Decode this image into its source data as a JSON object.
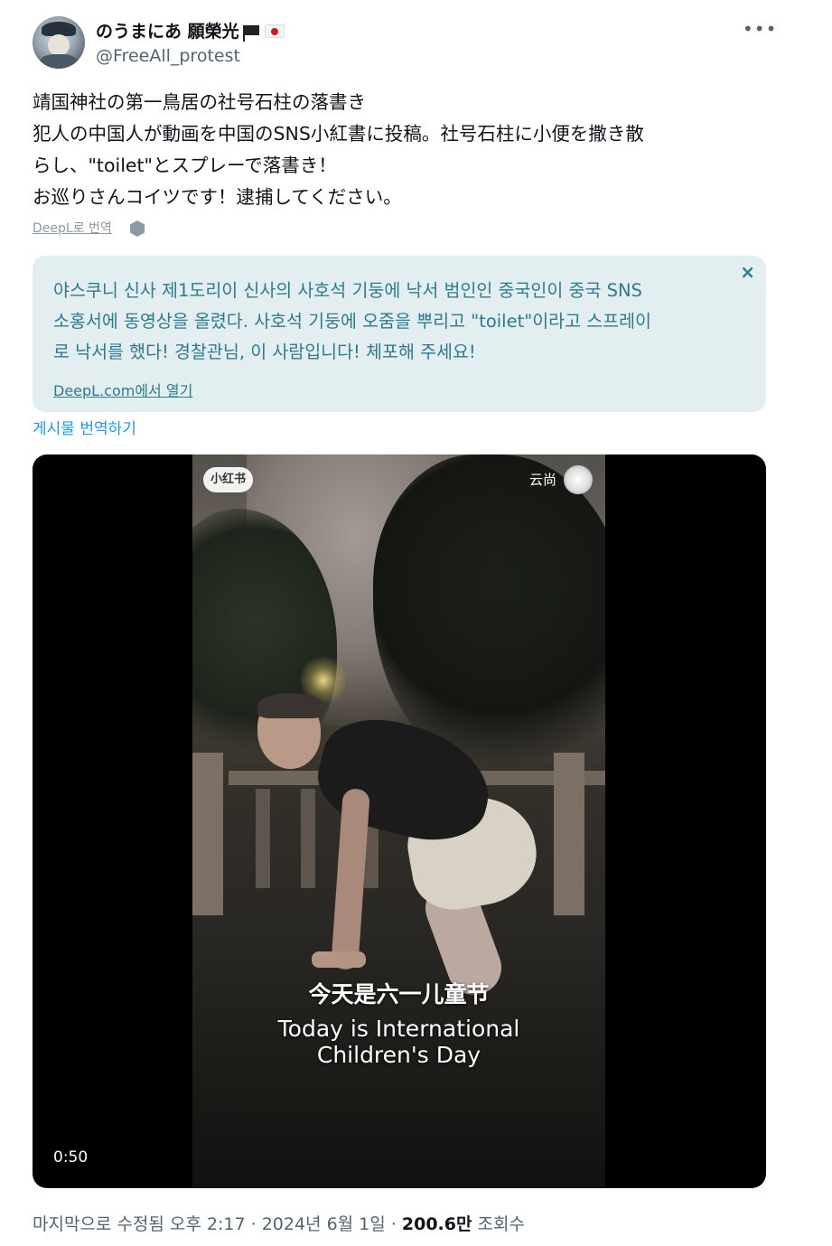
{
  "author": {
    "display_name": "のうまにあ 願榮光",
    "handle": "@FreeAll_protest",
    "badges": [
      "black-flag-icon",
      "japan-flag-icon"
    ]
  },
  "tweet": {
    "lines": [
      "靖国神社の第一鳥居の社号石柱の落書き",
      "犯人の中国人が動画を中国のSNS小紅書に投稿。社号石柱に小便を撒き散",
      "らし、\"toilet\"とスプレーで落書き！",
      "お巡りさんコイツです！逮捕してください。"
    ]
  },
  "deepl": {
    "translate_label": "DeepL로 번역",
    "translation_lines": [
      "야스쿠니 신사 제1도리이 신사의 사호석 기둥에 낙서 범인인 중국인이 중국 SNS",
      "소홍서에 동영상을 올렸다. 사호석 기둥에 오줌을 뿌리고 \"toilet\"이라고 스프레이",
      "로 낙서를 했다! 경찰관님, 이 사람입니다! 체포해 주세요!"
    ],
    "open_link": "DeepL.com에서 열기",
    "close_symbol": "×"
  },
  "translate_post_label": "게시물 번역하기",
  "video": {
    "watermark": "小红书",
    "author_name": "云尚",
    "subtitle_cn": "今天是六一儿童节",
    "subtitle_en_line1": "Today is International",
    "subtitle_en_line2": "Children's Day",
    "duration": "0:50"
  },
  "meta": {
    "edited_label": "마지막으로 수정됨 오후 2:17 · 2024년 6월 1일 · ",
    "views_count": "200.6만",
    "views_label": " 조회수"
  },
  "more_symbol": "•••"
}
